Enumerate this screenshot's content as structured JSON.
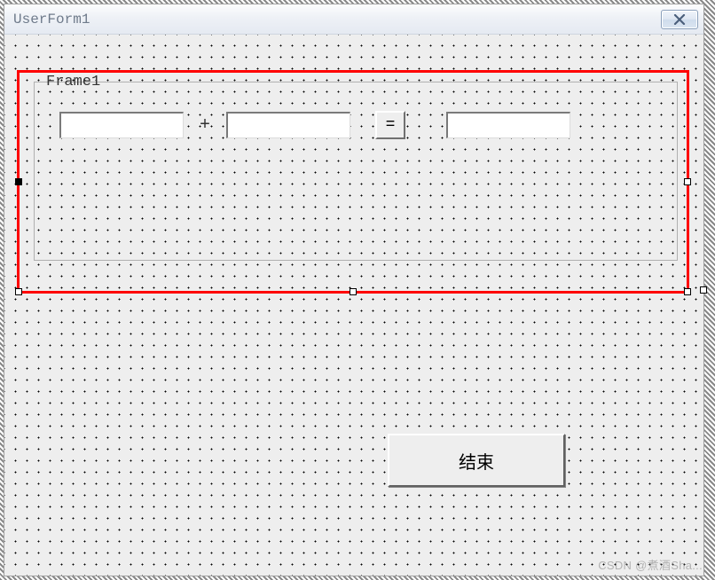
{
  "window": {
    "title": "UserForm1"
  },
  "frame": {
    "caption": "Frame1",
    "plus_label": "+",
    "equals_label": "=",
    "input1_value": "",
    "input2_value": "",
    "result_value": ""
  },
  "buttons": {
    "end_label": "结束"
  },
  "watermark": "CSDN @煮酒Sha..."
}
